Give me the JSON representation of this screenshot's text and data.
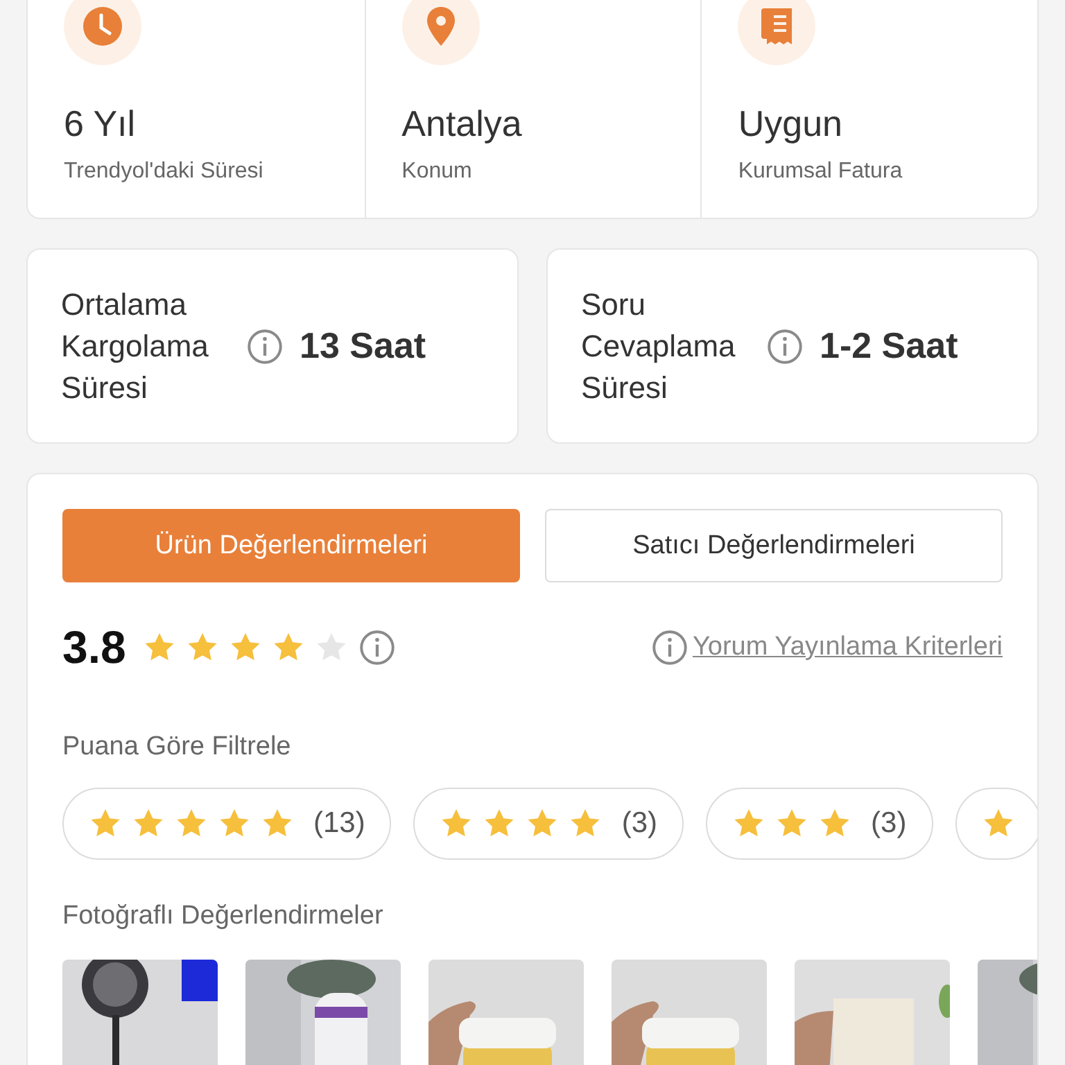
{
  "stats": [
    {
      "value": "6 Yıl",
      "label": "Trendyol'daki Süresi"
    },
    {
      "value": "Antalya",
      "label": "Konum"
    },
    {
      "value": "Uygun",
      "label": "Kurumsal Fatura"
    }
  ],
  "metrics": [
    {
      "label": "Ortalama Kargolama Süresi",
      "value": "13 Saat"
    },
    {
      "label": "Soru Cevaplama Süresi",
      "value": "1-2 Saat"
    }
  ],
  "tabs": [
    {
      "label": "Ürün Değerlendirmeleri",
      "selected": true
    },
    {
      "label": "Satıcı Değerlendirmeleri",
      "selected": false
    }
  ],
  "rating": {
    "score": "3.8",
    "stars": 4,
    "criteria_link": "Yorum Yayınlama Kriterleri"
  },
  "filter_title": "Puana Göre Filtrele",
  "filters": [
    {
      "kind": "full",
      "stars": 5,
      "count": "(13)"
    },
    {
      "kind": "full",
      "stars": 4,
      "count": "(3)"
    },
    {
      "kind": "full",
      "stars": 3,
      "count": "(3)"
    },
    {
      "kind": "cut"
    }
  ],
  "photos_title": "Fotoğraflı Değerlendirmeler"
}
